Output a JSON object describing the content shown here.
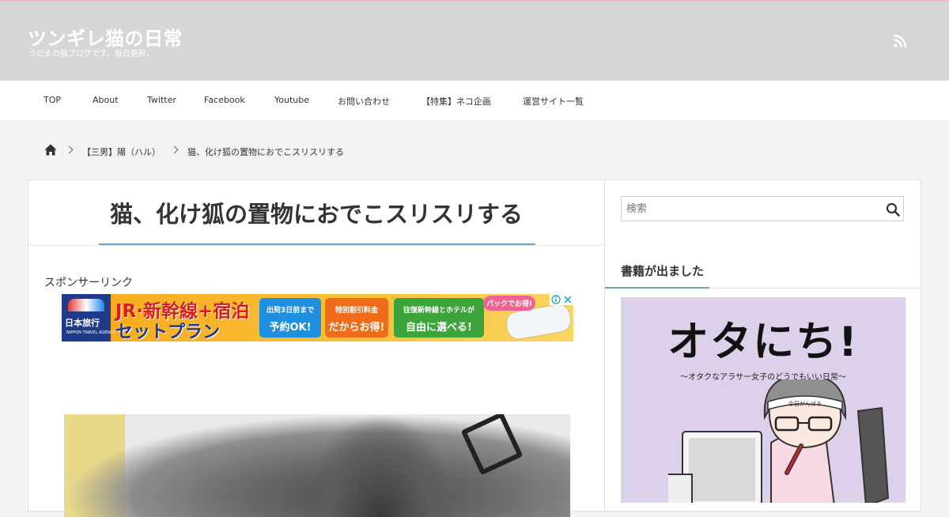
{
  "header": {
    "site_title": "ツンギレ猫の日常",
    "site_description": "うだまの猫ブログです。毎日更新。",
    "icons": {
      "rss": "rss-icon"
    },
    "colors": {
      "header_bg": "#d6d6d6",
      "top_line": "#f2b8c6",
      "accent": "#6aa4c2"
    }
  },
  "nav": {
    "items": [
      {
        "label": "TOP"
      },
      {
        "label": "About"
      },
      {
        "label": "Twitter"
      },
      {
        "label": "Facebook"
      },
      {
        "label": "Youtube"
      },
      {
        "label": "お問い合わせ"
      },
      {
        "label": "【特集】ネコ企画"
      },
      {
        "label": "運営サイト一覧"
      }
    ]
  },
  "breadcrumb": {
    "home_icon": "home-icon",
    "items": [
      {
        "label": "【三男】陽（ハル）"
      },
      {
        "label": "猫、化け狐の置物におでこスリスリする"
      }
    ]
  },
  "article": {
    "title": "猫、化け狐の置物におでこスリスリする",
    "sponsor_label": "スポンサーリンク",
    "ad": {
      "logo_text": "日本旅行",
      "logo_sub": "NIPPON TRAVEL AGENCY",
      "headline_1": "JR·新幹線+宿泊",
      "headline_2": "セットプラン",
      "box_1_top": "出発3日前まで",
      "box_1_bottom": "予約OK!",
      "box_2_top": "特別割引料金",
      "box_2_bottom": "だからお得!",
      "box_3_top": "往復新幹線とホテルが",
      "box_3_bottom": "自由に選べる!",
      "bubble": "パックでお得!"
    }
  },
  "sidebar": {
    "search": {
      "placeholder": "検索",
      "value": ""
    },
    "widget_title": "書籍が出ました",
    "book": {
      "title": "オタにち!",
      "subtitle": "〜オタクなアラサー女子のどうでもいい日常〜",
      "headband_text": "今日がんばる"
    }
  }
}
